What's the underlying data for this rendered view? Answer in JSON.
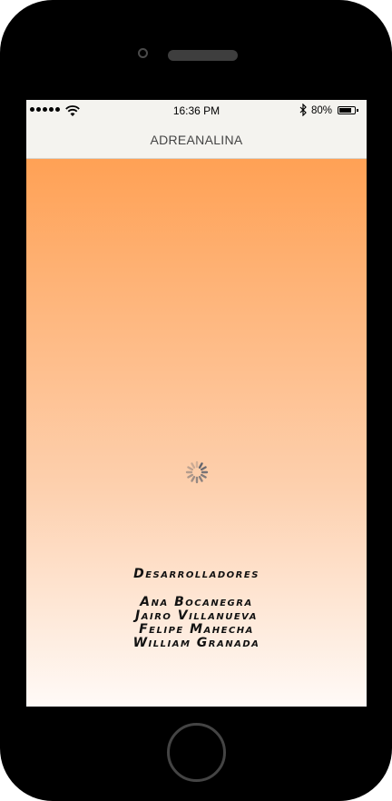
{
  "status_bar": {
    "time": "16:36 PM",
    "battery_percent": "80%",
    "battery_level": 0.8,
    "icons": [
      "signal-dots-icon",
      "wifi-icon",
      "bluetooth-icon",
      "battery-icon"
    ]
  },
  "nav_bar": {
    "title": "ADREANALINA"
  },
  "content": {
    "loading": true,
    "credits": {
      "heading": "Desarrolladores",
      "developers": [
        "Ana Bocanegra",
        "Jairo Villanueva",
        "Felipe Mahecha",
        "William Granada"
      ]
    }
  },
  "colors": {
    "gradient_top": "#ffa155",
    "gradient_bottom": "#fffaf7",
    "bar_background": "#f4f3ef"
  }
}
